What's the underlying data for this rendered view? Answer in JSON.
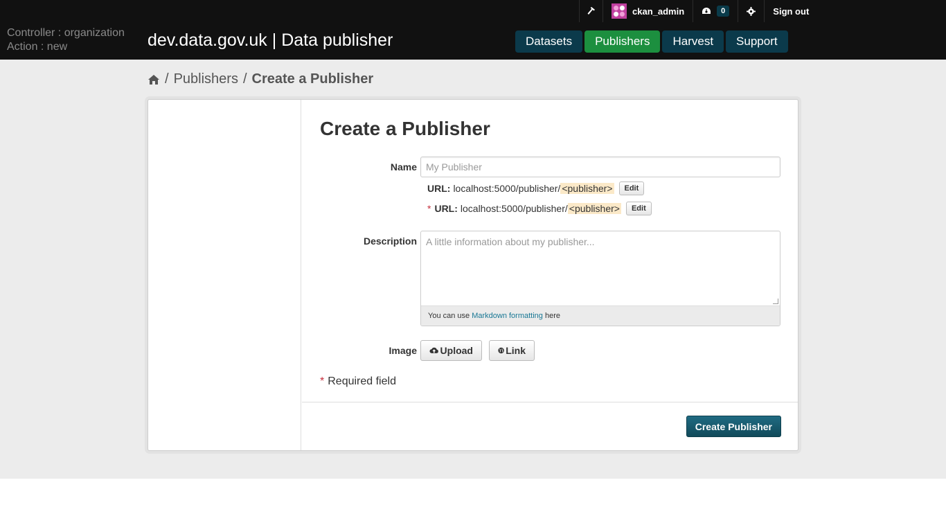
{
  "account": {
    "sysadmin_icon": "hammer-icon",
    "username": "ckan_admin",
    "dashboard_icon": "dashboard-icon",
    "dashboard_count": "0",
    "settings_icon": "gear-icon",
    "signout_label": "Sign out"
  },
  "debug": {
    "controller": "Controller : organization",
    "action": "Action : new"
  },
  "header": {
    "site_title": "dev.data.gov.uk | Data publisher",
    "nav": [
      {
        "label": "Datasets",
        "active": false
      },
      {
        "label": "Publishers",
        "active": true
      },
      {
        "label": "Harvest",
        "active": false
      },
      {
        "label": "Support",
        "active": false
      }
    ]
  },
  "breadcrumb": {
    "home_icon": "home-icon",
    "sep": "/",
    "publishers": "Publishers",
    "current": "Create a Publisher"
  },
  "form": {
    "heading": "Create a Publisher",
    "name_label": "Name",
    "name_placeholder": "My Publisher",
    "url1_label": "URL:",
    "url1_prefix": "localhost:5000/publisher/",
    "url1_slug": "<publisher>",
    "url1_edit": "Edit",
    "url2_required_mark": "*",
    "url2_label": "URL:",
    "url2_prefix": "localhost:5000/publisher/",
    "url2_slug": "<publisher>",
    "url2_edit": "Edit",
    "description_label": "Description",
    "description_placeholder": "A little information about my publisher...",
    "markdown_pre": "You can use ",
    "markdown_link": "Markdown formatting",
    "markdown_post": " here",
    "image_label": "Image",
    "upload_label": "Upload",
    "link_label": "Link",
    "required_mark": "*",
    "required_text": "Required field",
    "submit_label": "Create Publisher"
  },
  "colors": {
    "masthead": "#111111",
    "nav": "#0b3a4b",
    "nav_active": "#1c8f3f",
    "primary_button": "#176278",
    "required": "#c6303e"
  }
}
